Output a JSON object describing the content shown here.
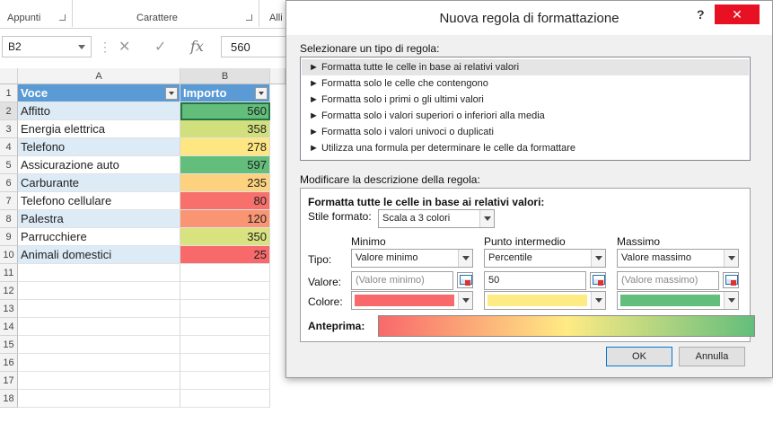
{
  "ribbon": {
    "groups": [
      "Appunti",
      "Carattere",
      "Alli"
    ]
  },
  "namebox": {
    "value": "B2"
  },
  "formula": {
    "value": "560",
    "fx_label": "fx"
  },
  "grid": {
    "columns": [
      "A",
      "B"
    ],
    "row_numbers": [
      "1",
      "2",
      "3",
      "4",
      "5",
      "6",
      "7",
      "8",
      "9",
      "10",
      "11",
      "12",
      "13",
      "14",
      "15",
      "16",
      "17",
      "18"
    ],
    "header": {
      "voce": "Voce",
      "importo": "Importo"
    },
    "rows": [
      {
        "voce": "Affitto",
        "importo": "560",
        "color": "#63be7b"
      },
      {
        "voce": "Energia elettrica",
        "importo": "358",
        "color": "#d1e07d"
      },
      {
        "voce": "Telefono",
        "importo": "278",
        "color": "#fee782"
      },
      {
        "voce": "Assicurazione auto",
        "importo": "597",
        "color": "#63be7b"
      },
      {
        "voce": "Carburante",
        "importo": "235",
        "color": "#fdd27f"
      },
      {
        "voce": "Telefono cellulare",
        "importo": "80",
        "color": "#f8706c"
      },
      {
        "voce": "Palestra",
        "importo": "120",
        "color": "#fa9573"
      },
      {
        "voce": "Parrucchiere",
        "importo": "350",
        "color": "#d8e27e"
      },
      {
        "voce": "Animali domestici",
        "importo": "25",
        "color": "#f8696b"
      }
    ]
  },
  "dialog": {
    "title": "Nuova regola di formattazione",
    "help": "?",
    "close": "✕",
    "select_type_label": "Selezionare un tipo di regola:",
    "rule_types": [
      "► Formatta tutte le celle in base ai relativi valori",
      "► Formatta solo le celle che contengono",
      "► Formatta solo i primi o gli ultimi valori",
      "► Formatta solo i valori superiori o inferiori alla media",
      "► Formatta solo i valori univoci o duplicati",
      "► Utilizza una formula per determinare le celle da formattare"
    ],
    "edit_desc_label": "Modificare la descrizione della regola:",
    "desc_heading": "Formatta tutte le celle in base ai relativi valori:",
    "stile_label": "Stile formato:",
    "stile_value": "Scala a 3 colori",
    "col_min": "Minimo",
    "col_mid": "Punto intermedio",
    "col_max": "Massimo",
    "tipo_label": "Tipo:",
    "valore_label": "Valore:",
    "colore_label": "Colore:",
    "tipo_min": "Valore minimo",
    "tipo_mid": "Percentile",
    "tipo_max": "Valore massimo",
    "valore_min": "(Valore minimo)",
    "valore_mid": "50",
    "valore_max": "(Valore massimo)",
    "colors": {
      "min": "#f8696b",
      "mid": "#ffeb84",
      "max": "#63be7b"
    },
    "anteprima_label": "Anteprima:",
    "ok": "OK",
    "cancel": "Annulla"
  }
}
